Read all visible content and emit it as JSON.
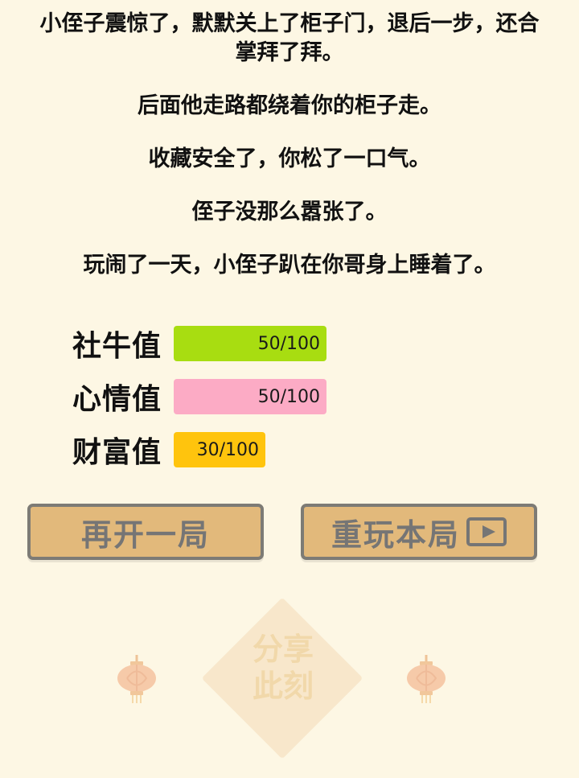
{
  "story": {
    "line1": "小侄子震惊了，默默关上了柜子门，退后一步，还合掌拜了拜。",
    "line2": "后面他走路都绕着你的柜子走。",
    "line3": "收藏安全了，你松了一口气。",
    "line4": "侄子没那么嚣张了。",
    "line5": "玩闹了一天，小侄子趴在你哥身上睡着了。"
  },
  "stats": [
    {
      "label": "社牛值",
      "value": 50,
      "max": 100,
      "text": "50/100",
      "color": "#a8dd11"
    },
    {
      "label": "心情值",
      "value": 50,
      "max": 100,
      "text": "50/100",
      "color": "#fcabc5"
    },
    {
      "label": "财富值",
      "value": 30,
      "max": 100,
      "text": "30/100",
      "color": "#ffc40d"
    }
  ],
  "buttons": {
    "new_game": "再开一局",
    "replay": "重玩本局"
  },
  "share": {
    "line1": "分享",
    "line2": "此刻"
  },
  "icons": {
    "replay_icon": "play-icon",
    "lantern_icon": "lantern-icon"
  }
}
